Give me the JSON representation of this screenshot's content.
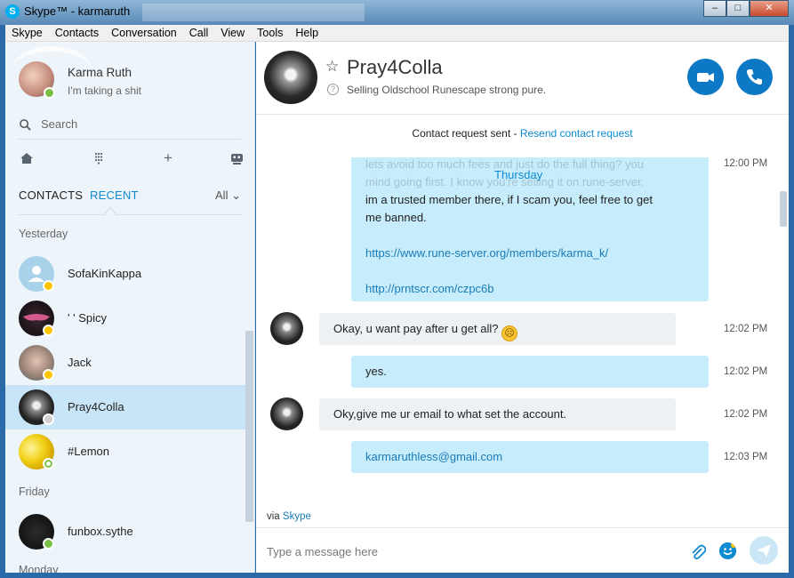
{
  "window": {
    "title": "Skype™ - karmaruth"
  },
  "menu": [
    "Skype",
    "Contacts",
    "Conversation",
    "Call",
    "View",
    "Tools",
    "Help"
  ],
  "profile": {
    "name": "Karma Ruth",
    "mood": "I'm taking a shit"
  },
  "search": {
    "placeholder": "Search"
  },
  "tabs": {
    "contacts": "CONTACTS",
    "recent": "RECENT",
    "filter": "All"
  },
  "sections": {
    "yesterday": "Yesterday",
    "friday": "Friday",
    "monday": "Monday"
  },
  "contacts": [
    {
      "name": "SofaKinKappa",
      "status": "away"
    },
    {
      "name": "' ' Spicy",
      "status": "away"
    },
    {
      "name": "Jack",
      "status": "away"
    },
    {
      "name": "Pray4Colla",
      "status": "unknown",
      "selected": true
    },
    {
      "name": "#Lemon",
      "status": "offline"
    },
    {
      "name": "funbox.sythe",
      "status": "online"
    }
  ],
  "conversation": {
    "name": "Pray4Colla",
    "mood": "Selling Oldschool Runescape strong pure.",
    "notice": "Contact request sent - ",
    "notice_link": "Resend contact request",
    "day": "Thursday",
    "faded_time": "12:00 PM",
    "faded_lines": [
      "lets avoid too much fees and just do the full thing? you",
      "mind going first. I know you're selling it on rune-server."
    ],
    "msg1_line": "im a trusted member there, if I scam you, feel free to get",
    "msg1_line2": "me banned.",
    "msg1_link1": "https://www.rune-server.org/members/karma_k/",
    "msg1_link2": "http://prntscr.com/czpc6b",
    "messages": [
      {
        "from": "them",
        "text": "Okay, u want pay after u get all?",
        "time": "12:02 PM"
      },
      {
        "from": "me",
        "text": "yes.",
        "time": "12:02 PM"
      },
      {
        "from": "them",
        "text": "Oky,give me ur email to what set the account.",
        "time": "12:02 PM"
      },
      {
        "from": "me",
        "text": "karmaruthless@gmail.com",
        "time": "12:03 PM"
      }
    ],
    "via": "via ",
    "via_link": "Skype",
    "compose_placeholder": "Type a message here"
  },
  "colors": {
    "accent": "#0e8bd1",
    "call_button": "#0d78c5",
    "selected_row": "#c8e5f7",
    "my_bubble": "#c7edfc"
  }
}
